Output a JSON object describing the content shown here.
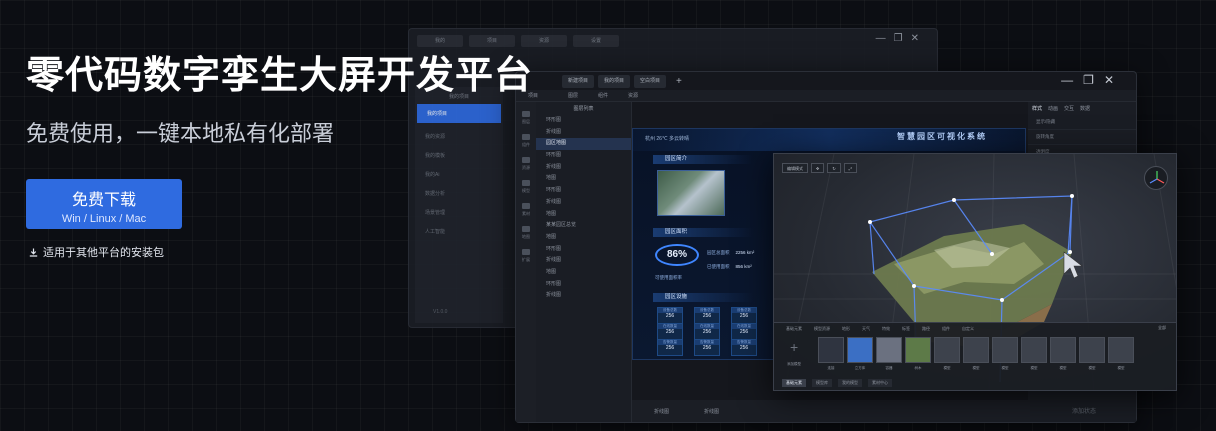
{
  "hero": {
    "title": "零代码数字孪生大屏开发平台",
    "subtitle": "免费使用，一键本地私有化部署",
    "download_label": "免费下载",
    "download_platforms": "Win / Linux / Mac",
    "other_platforms": "适用于其他平台的安装包"
  },
  "back_window": {
    "tabs": [
      "我的",
      "项目",
      "资源",
      "设置"
    ],
    "sidebar_header": "我的项目",
    "sidebar_items": [
      "我的项目",
      "我的资源",
      "我的模板",
      "我的Ai",
      "数据分析",
      "场景管理",
      "人工智能"
    ],
    "version": "V1.0.0"
  },
  "main_window": {
    "tabs": [
      "新建项目",
      "我的项目",
      "空白项目"
    ],
    "toolbar": [
      "项目",
      "图层",
      "组件",
      "资源",
      "素材"
    ],
    "icon_rail": [
      "图层",
      "组件",
      "资源",
      "模型",
      "素材",
      "地图",
      "扩展"
    ],
    "layers_header": "图层列表",
    "layers": [
      "环形图",
      "折线图",
      "地图",
      "环形图",
      "折线图",
      "地图",
      "环形图",
      "折线图",
      "地图",
      "某某园区总览",
      "地图",
      "环形图",
      "折线图",
      "地图",
      "环形图",
      "折线图"
    ],
    "selected_layer_index": 2,
    "selected_layer_label": "园区地图",
    "right_tabs": [
      "样式",
      "动画",
      "交互",
      "数据"
    ],
    "right_items": [
      "显示/隐藏",
      "旋转角度",
      "透明度",
      "位置"
    ],
    "bottom_items": [
      "折线图",
      "折线图"
    ],
    "add_state": "添加状态"
  },
  "dashboard": {
    "title": "智慧园区可视化系统",
    "weather": "杭州  26℃  多云转晴",
    "card1_title": "园区简介",
    "card2_title": "园区面积",
    "card3_title": "园区设施",
    "gauge_value": "86%",
    "gauge_label": "可使用面积率",
    "stat1_label": "园区总面积",
    "stat1_value": "2256 km²",
    "stat2_label": "已使用面积",
    "stat2_value": "856 km²",
    "cells": [
      {
        "label": "设备总数",
        "value": "256"
      },
      {
        "label": "设备总数",
        "value": "256"
      },
      {
        "label": "设备总数",
        "value": "256"
      },
      {
        "label": "在线数量",
        "value": "256"
      },
      {
        "label": "在线数量",
        "value": "256"
      },
      {
        "label": "在线数量",
        "value": "256"
      },
      {
        "label": "告警数量",
        "value": "256"
      },
      {
        "label": "告警数量",
        "value": "256"
      },
      {
        "label": "告警数量",
        "value": "256"
      }
    ]
  },
  "viewer": {
    "mode_label": "编辑模式",
    "asset_tabs": [
      "基础元素",
      "模型资源",
      "地形",
      "天气",
      "特效",
      "标签",
      "路径",
      "组件",
      "自定义"
    ],
    "asset_select": "全部",
    "add_label": "添加模型",
    "assets": [
      "连接",
      "立方体",
      "容器",
      "树木",
      "模型",
      "模型",
      "模型",
      "模型",
      "模型",
      "模型",
      "模型"
    ],
    "foot": [
      "基础元素",
      "模型库",
      "我的模型",
      "素材中心"
    ]
  },
  "colors": {
    "accent": "#2f6be0",
    "background": "#0c0e13",
    "highlight": "#3f86ff"
  }
}
